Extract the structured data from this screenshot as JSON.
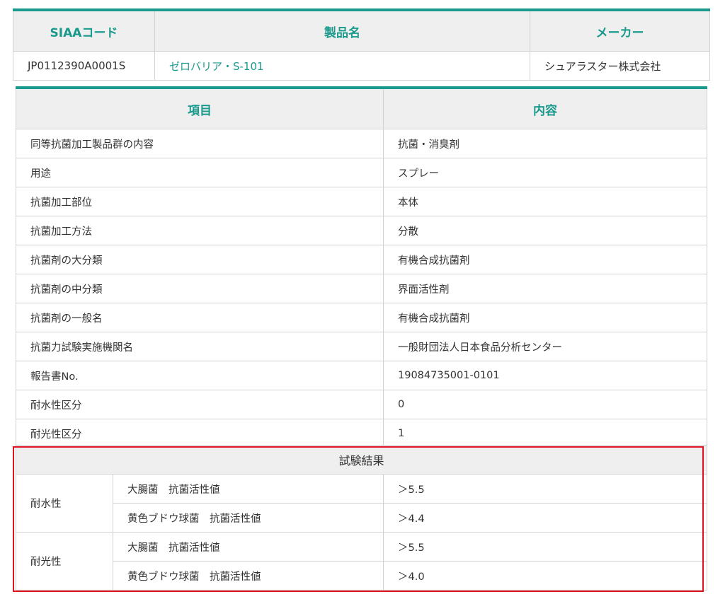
{
  "product": {
    "headers": {
      "code": "SIAAコード",
      "name": "製品名",
      "maker": "メーカー"
    },
    "code": "JP0112390A0001S",
    "name": "ゼロバリア・S-101",
    "maker": "シュアラスター株式会社"
  },
  "details": {
    "header_item": "項目",
    "header_content": "内容",
    "rows": [
      {
        "label": "同等抗菌加工製品群の内容",
        "value": "抗菌・消臭剤"
      },
      {
        "label": "用途",
        "value": "スプレー"
      },
      {
        "label": "抗菌加工部位",
        "value": "本体"
      },
      {
        "label": "抗菌加工方法",
        "value": "分散"
      },
      {
        "label": "抗菌剤の大分類",
        "value": "有機合成抗菌剤"
      },
      {
        "label": "抗菌剤の中分類",
        "value": "界面活性剤"
      },
      {
        "label": "抗菌剤の一般名",
        "value": "有機合成抗菌剤"
      },
      {
        "label": "抗菌力試験実施機関名",
        "value": "一般財団法人日本食品分析センター"
      },
      {
        "label": "報告書No.",
        "value": "19084735001-0101"
      },
      {
        "label": "耐水性区分",
        "value": "0"
      },
      {
        "label": "耐光性区分",
        "value": "1"
      }
    ]
  },
  "results": {
    "title": "試験結果",
    "groups": [
      {
        "name": "耐水性",
        "items": [
          {
            "label": "大腸菌　抗菌活性値",
            "value": "＞5.5"
          },
          {
            "label": "黄色ブドウ球菌　抗菌活性値",
            "value": "＞4.4"
          }
        ]
      },
      {
        "name": "耐光性",
        "items": [
          {
            "label": "大腸菌　抗菌活性値",
            "value": "＞5.5"
          },
          {
            "label": "黄色ブドウ球菌　抗菌活性値",
            "value": "＞4.0"
          }
        ]
      }
    ]
  },
  "colors": {
    "accent": "#1a9a8c",
    "highlight": "#e0141e",
    "header_bg": "#efefef"
  }
}
